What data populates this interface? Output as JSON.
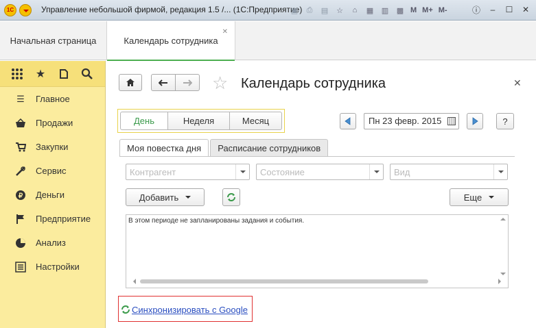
{
  "window": {
    "title": "Управление небольшой фирмой, редакция 1.5 /...  (1С:Предприятие)",
    "logo_text": "1С",
    "memory_buttons": [
      "M",
      "M+",
      "M-"
    ],
    "icons": [
      "save-icon",
      "print-icon",
      "preview-icon",
      "favorites-icon",
      "bookmark-icon",
      "spreadsheet-icon",
      "calendar-icon",
      "calculator-icon",
      "info-icon",
      "minimize-icon",
      "maximize-icon",
      "close-icon"
    ]
  },
  "tabs": [
    {
      "label": "Начальная страница",
      "active": false
    },
    {
      "label": "Календарь сотрудника",
      "active": true
    }
  ],
  "sidebar": {
    "tools": [
      "apps-grid-icon",
      "star-icon",
      "history-icon",
      "search-icon"
    ],
    "items": [
      {
        "label": "Главное",
        "icon": "menu-lines-icon"
      },
      {
        "label": "Продажи",
        "icon": "basket-icon"
      },
      {
        "label": "Закупки",
        "icon": "cart-icon"
      },
      {
        "label": "Сервис",
        "icon": "tools-icon"
      },
      {
        "label": "Деньги",
        "icon": "coin-icon"
      },
      {
        "label": "Предприятие",
        "icon": "flag-icon"
      },
      {
        "label": "Анализ",
        "icon": "pie-chart-icon"
      },
      {
        "label": "Настройки",
        "icon": "settings-list-icon"
      }
    ]
  },
  "form": {
    "title": "Календарь сотрудника",
    "period": {
      "options": [
        "День",
        "Неделя",
        "Месяц"
      ],
      "selected": "День"
    },
    "date": "Пн 23 февр. 2015",
    "help_label": "?",
    "inner_tabs": [
      {
        "label": "Моя повестка дня",
        "active": true
      },
      {
        "label": "Расписание сотрудников",
        "active": false
      }
    ],
    "filters": {
      "counterparty_placeholder": "Контрагент",
      "status_placeholder": "Состояние",
      "kind_placeholder": "Вид"
    },
    "add_label": "Добавить",
    "more_label": "Еще",
    "events_message": "В этом периоде не запланированы задания и события.",
    "sync_link": "Синхронизировать с Google"
  },
  "colors": {
    "sidebar_bg": "#fbec9e",
    "accent_green": "#3a9a4a",
    "link_blue": "#2a4ec0",
    "highlight_red": "#e03030"
  }
}
